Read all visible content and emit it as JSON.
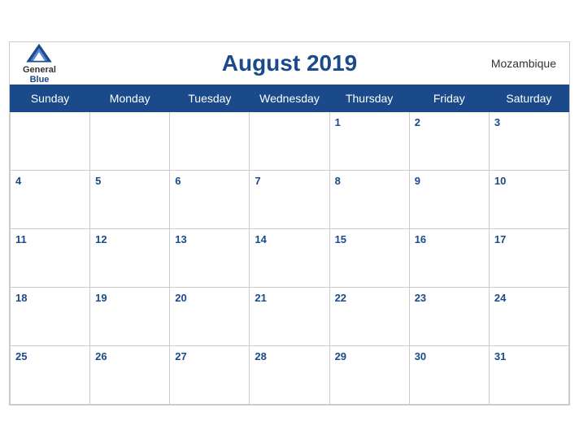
{
  "header": {
    "title": "August 2019",
    "country": "Mozambique",
    "logo": {
      "general": "General",
      "blue": "Blue"
    }
  },
  "weekdays": [
    "Sunday",
    "Monday",
    "Tuesday",
    "Wednesday",
    "Thursday",
    "Friday",
    "Saturday"
  ],
  "weeks": [
    [
      null,
      null,
      null,
      null,
      1,
      2,
      3
    ],
    [
      4,
      5,
      6,
      7,
      8,
      9,
      10
    ],
    [
      11,
      12,
      13,
      14,
      15,
      16,
      17
    ],
    [
      18,
      19,
      20,
      21,
      22,
      23,
      24
    ],
    [
      25,
      26,
      27,
      28,
      29,
      30,
      31
    ]
  ],
  "accent_color": "#1a4a8a"
}
